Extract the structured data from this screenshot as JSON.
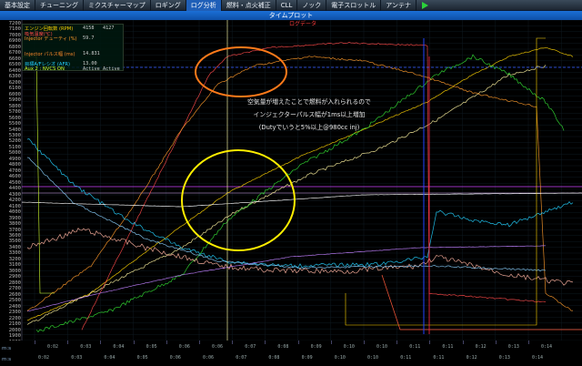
{
  "tabs": [
    "基本設定",
    "チューニング",
    "ミクスチャーマップ",
    "ロギング",
    "ログ分析",
    "燃料・点火補正",
    "CLL",
    "ノック",
    "電子スロットル",
    "アンテナ"
  ],
  "active_tab": 4,
  "title": "タイムプロット",
  "subtitle": "ログデータ",
  "y_ticks": [
    "7200",
    "7100",
    "7000",
    "6900",
    "6800",
    "6700",
    "6600",
    "6500",
    "6400",
    "6300",
    "6200",
    "6100",
    "6000",
    "5900",
    "5800",
    "5700",
    "5600",
    "5500",
    "5400",
    "5300",
    "5200",
    "5100",
    "5000",
    "4900",
    "4800",
    "4700",
    "4600",
    "4500",
    "4400",
    "4300",
    "4200",
    "4100",
    "4000",
    "3900",
    "3800",
    "3700",
    "3600",
    "3500",
    "3400",
    "3300",
    "3200",
    "3100",
    "3000",
    "2900",
    "2800",
    "2700",
    "2600",
    "2500",
    "2400",
    "2300",
    "2200",
    "2100",
    "2000",
    "1900",
    "1800"
  ],
  "legend": [
    {
      "name": "エンジン回転数 (RPM)",
      "v1": "4158",
      "v2": "4127",
      "color": "#ffd400"
    },
    {
      "name": "吸気温度(℃)",
      "v1": "",
      "v2": "",
      "color": "#ff4a4a"
    },
    {
      "name": "Injector デューティ (%)",
      "v1": "59.7",
      "v2": "",
      "color": "#ff9a2a"
    },
    {
      "name": "",
      "v1": "",
      "v2": "",
      "color": "#40a0ff"
    },
    {
      "name": "",
      "v1": "",
      "v2": "",
      "color": "#40a0ff"
    },
    {
      "name": "Injector パルス幅 (ms)",
      "v1": "14.831",
      "v2": "",
      "color": "#ff8a2a"
    },
    {
      "name": "",
      "v1": "",
      "v2": "",
      "color": "#ff8a2a"
    },
    {
      "name": "目標A/Fレシオ (AFR)",
      "v1": "13.00",
      "v2": "",
      "color": "#22d0ff"
    },
    {
      "name": "Aux 2 : NVCS ON",
      "v1": "Active",
      "v2": "Active",
      "color": "#d0ff30"
    }
  ],
  "annotation": [
    "空気量が増えたことで燃料が入れられるので",
    "インジェクターパルス幅が1ms以上増加",
    "(Dutyでいうと5%以上@980cc inj)"
  ],
  "x_ticks": [
    "0:02",
    "0:03",
    "0:04",
    "0:05",
    "0:06",
    "0:06",
    "0:07",
    "0:08",
    "0:09",
    "0:10",
    "0:10",
    "0:11",
    "0:11",
    "0:12",
    "0:13",
    "0:14"
  ],
  "x_label": "m:s",
  "colors": {
    "rpm": "#ffd400",
    "iat": "#ff4a4a",
    "duty": "#ff9a2a",
    "pw": "#ff8a2a",
    "afr": "#22d0ff",
    "aux": "#d0ff30",
    "green": "#33dd33",
    "magenta": "#cc44ff",
    "annot_orange": "#ff7a1a",
    "annot_yellow": "#ffee00"
  }
}
